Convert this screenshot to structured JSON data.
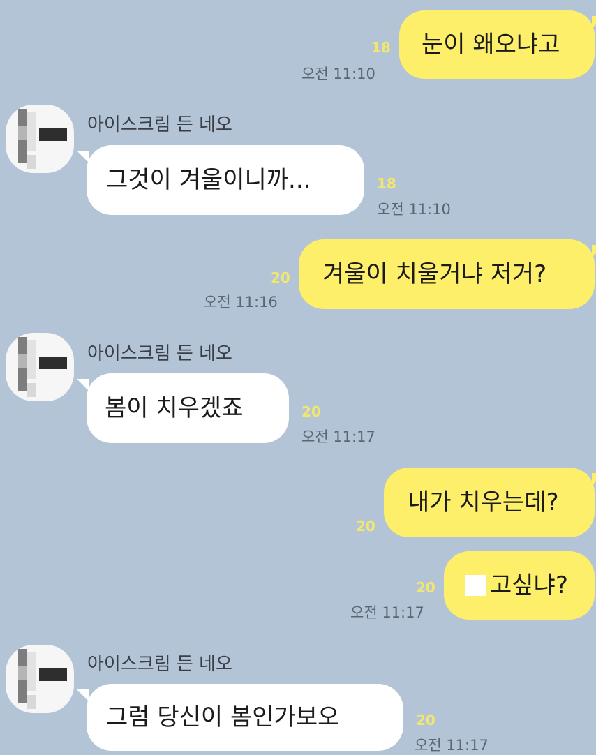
{
  "contact_name": "아이스크림 든 네오",
  "messages": [
    {
      "side": "mine",
      "text": "눈이 왜오냐고",
      "unread": "18",
      "time": "오전 11:10"
    },
    {
      "side": "theirs",
      "text": "그것이 겨울이니까...",
      "unread": "18",
      "time": "오전 11:10"
    },
    {
      "side": "mine",
      "text": "겨울이 치울거냐 저거?",
      "unread": "20",
      "time": "오전 11:16"
    },
    {
      "side": "theirs",
      "text": "봄이 치우겠죠",
      "unread": "20",
      "time": "오전 11:17"
    },
    {
      "side": "mine",
      "text": "내가 치우는데?",
      "unread": "20",
      "time": ""
    },
    {
      "side": "mine",
      "text": "고싶냐?",
      "unread": "20",
      "time": "오전 11:17",
      "redacted_prefix": true
    },
    {
      "side": "theirs",
      "text": "그럼 당신이 봄인가보오",
      "unread": "20",
      "time": "오전 11:17"
    }
  ],
  "colors": {
    "background": "#b3c4d7",
    "my_bubble": "#fdef6a",
    "their_bubble": "#ffffff",
    "unread_count": "#f3e66f",
    "time_text": "#5b6675"
  }
}
